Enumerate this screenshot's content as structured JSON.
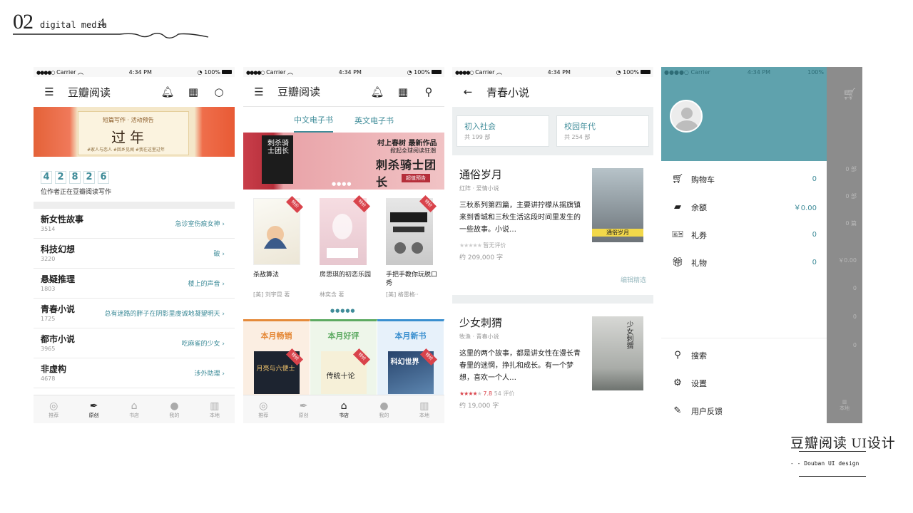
{
  "page": {
    "number": "02",
    "subtitle": "digital media",
    "subtitle_num": "4",
    "footer_title": "豆瓣阅读 UI设计",
    "footer_sub": "- - Douban UI design"
  },
  "colors": {
    "teal": "#3f8c99",
    "drawer": "#5fa2ad",
    "red": "#d9434b"
  },
  "status": {
    "carrier": "Carrier",
    "time": "4:34 PM",
    "battery": "100%"
  },
  "screen1": {
    "title": "豆瓣阅读",
    "banner": {
      "top": "短篇写作 · 活动预告",
      "big": "过年",
      "tags": "#家人与恋人   #回乡见闻   #我在这里过年"
    },
    "digits": [
      "4",
      "2",
      "8",
      "2",
      "6"
    ],
    "counter_label": "位作者正在豆瓣阅读写作",
    "categories": [
      {
        "name": "新女性故事",
        "count": "3514",
        "right": "急诊室伤痕女神"
      },
      {
        "name": "科技幻想",
        "count": "3220",
        "right": "破"
      },
      {
        "name": "悬疑推理",
        "count": "1803",
        "right": "楼上的声音"
      },
      {
        "name": "青春小说",
        "count": "1725",
        "right": "总有迷路的胖子在阴影里虔诚地凝望明天"
      },
      {
        "name": "都市小说",
        "count": "3965",
        "right": "吃麻雀的少女"
      },
      {
        "name": "非虚构",
        "count": "4678",
        "right": "涉外助理"
      }
    ],
    "tabs": [
      "推荐",
      "原创",
      "书店",
      "我的",
      "本地"
    ]
  },
  "screen2": {
    "title": "豆瓣阅读",
    "subtabs": [
      "中文电子书",
      "英文电子书"
    ],
    "banner": {
      "book": "刺杀骑士团长",
      "line1": "村上春树  最新作品",
      "line2": "掀起全球阅读狂潮",
      "line3": "刺杀骑士团长",
      "line4": "超值预告"
    },
    "tag": "特价",
    "books": [
      {
        "title": "杀敌算法",
        "author": "[美] 刘宇昆 著"
      },
      {
        "title": "房思琪的初恋乐园",
        "author": "林奕含 著"
      },
      {
        "title": "手把手教你玩脱口秀",
        "author": "[美] 格雷格··"
      }
    ],
    "columns": [
      {
        "title": "本月畅销",
        "color": "#e58a3a",
        "cover": "月亮与六便士"
      },
      {
        "title": "本月好评",
        "color": "#5daa62",
        "cover": "传统十论"
      },
      {
        "title": "本月新书",
        "color": "#3a8fcf",
        "cover": "科幻世界"
      }
    ],
    "tabs": [
      "推荐",
      "原创",
      "书店",
      "我的",
      "本地"
    ]
  },
  "screen3": {
    "title": "青春小说",
    "pills": [
      {
        "name": "初入社会",
        "count": "共 199 部"
      },
      {
        "name": "校园年代",
        "count": "共 254 部"
      }
    ],
    "items": [
      {
        "title": "通俗岁月",
        "meta": "红阵 · 爱情小说",
        "desc": "三秋系列第四篇，主要讲拧檬从摇旗镇来到香城和三秋生活这段时间里发生的一些故事。小说…",
        "rating_text": "暂无评价",
        "score": "",
        "words": "约 209,000 字",
        "cover": "通俗岁月"
      },
      {
        "title": "少女刺猬",
        "meta": "牧渔 · 青春小说",
        "desc": "这里的两个故事，都是讲女性在漫长青春里的迷惘，挣扎和成长。有一个梦想，喜欢一个人…",
        "rating_text": "54 评价",
        "score": "7.8",
        "words": "约 19,000 字",
        "cover": "少女刺猬"
      }
    ],
    "more": "编辑精选"
  },
  "screen4": {
    "items": [
      {
        "icon": "cart-icon",
        "label": "购物车",
        "value": "0"
      },
      {
        "icon": "wallet-icon",
        "label": "余额",
        "value": "￥0.00"
      },
      {
        "icon": "ticket-icon",
        "label": "礼券",
        "value": "0"
      },
      {
        "icon": "gift-icon",
        "label": "礼物",
        "value": "0"
      }
    ],
    "bottom": [
      {
        "icon": "search-icon",
        "label": "搜索"
      },
      {
        "icon": "gear-icon",
        "label": "设置"
      },
      {
        "icon": "feedback-icon",
        "label": "用户反馈"
      }
    ],
    "scrim_values": [
      "0 部",
      "0 部",
      "0 篇",
      "￥0.00",
      "0",
      "0",
      "0"
    ],
    "scrim_tab": "本地"
  }
}
